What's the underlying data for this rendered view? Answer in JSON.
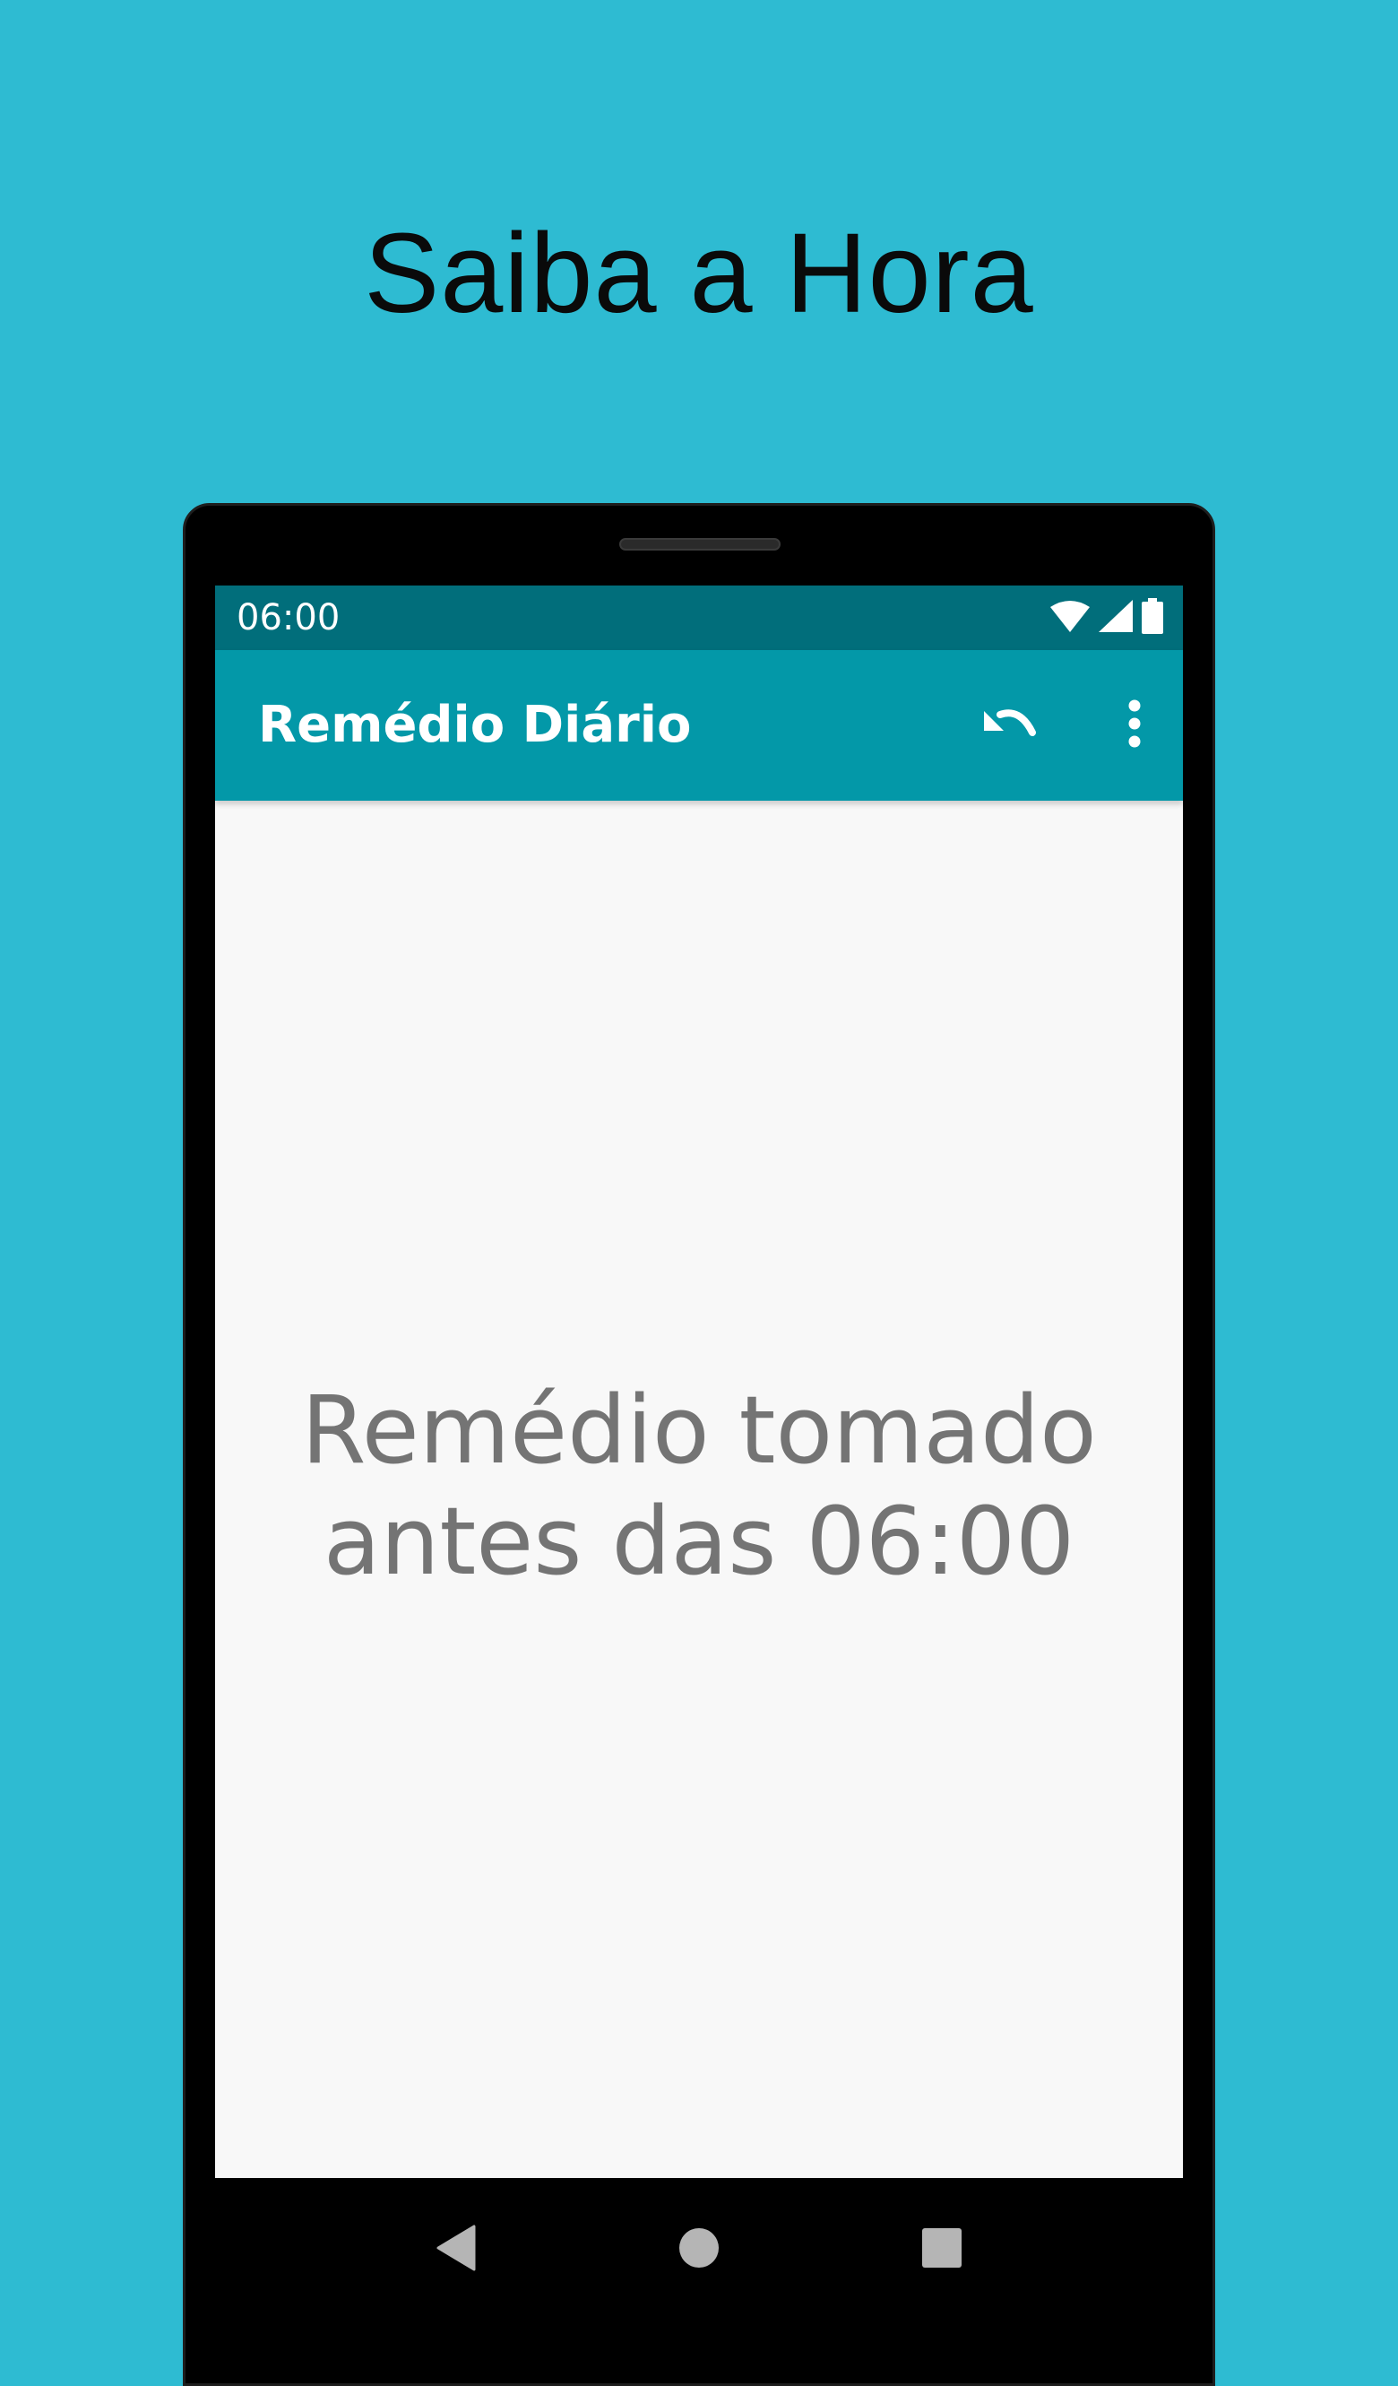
{
  "promo": {
    "title": "Saiba a Hora"
  },
  "status_bar": {
    "time": "06:00",
    "icons": [
      "wifi-icon",
      "cell-signal-icon",
      "battery-icon"
    ]
  },
  "app_bar": {
    "title": "Remédio Diário",
    "actions": [
      "undo-icon",
      "more-vert-icon"
    ]
  },
  "content": {
    "message_line1": "Remédio tomado",
    "message_line2": "antes das 06:00"
  },
  "nav_bar": {
    "buttons": [
      "back-icon",
      "home-icon",
      "recents-icon"
    ]
  },
  "colors": {
    "background": "#2ebbd2",
    "status_bar": "#016e7b",
    "app_bar": "#0398a8",
    "screen": "#f8f8f8",
    "message_text": "#747474"
  }
}
